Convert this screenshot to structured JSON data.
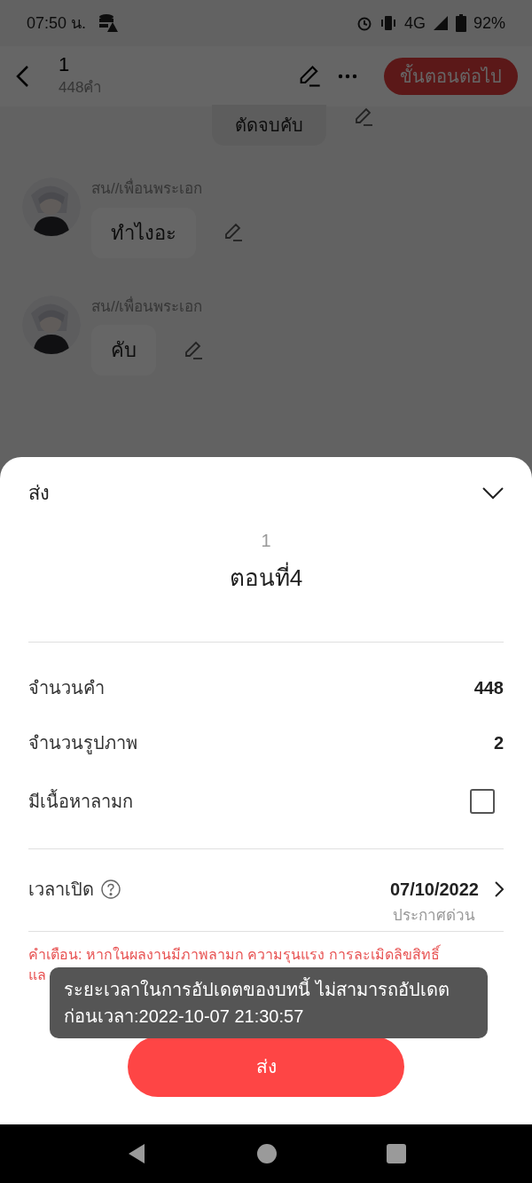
{
  "status_bar": {
    "time": "07:50 น.",
    "battery": "92%",
    "network": "4G"
  },
  "header": {
    "title": "1",
    "subtitle": "448คำ",
    "next_button": "ขั้นตอนต่อไป"
  },
  "messages": [
    {
      "kind": "self",
      "text": "ตัดจบคับ"
    },
    {
      "kind": "character",
      "name": "สน//เพื่อนพระเอก",
      "text": "ทำไงอะ"
    },
    {
      "kind": "character",
      "name": "สน//เพื่อนพระเอก",
      "text": "คับ"
    }
  ],
  "sheet": {
    "title": "ส่ง",
    "work_title": "1",
    "chapter_title": "ตอนที่4",
    "stats": [
      {
        "label": "จำนวนคำ",
        "value": "448"
      },
      {
        "label": "จำนวนรูปภาพ",
        "value": "2"
      }
    ],
    "adult_content": {
      "label": "มีเนื้อหาลามก",
      "checked": false
    },
    "release": {
      "label": "เวลาเปิด",
      "date": "07/10/2022",
      "note": "ประกาศด่วน"
    },
    "warning": [
      "คำเตือน: หากในผลงานมีภาพลามก ความรุนแรง การละเมิดลิขสิทธิ์",
      "แล"
    ],
    "submit_button": "ส่ง"
  },
  "toast": "ระยะเวลาในการอัปเดตของบทนี้ ไม่สามารถอัปเดตก่อนเวลา:2022-10-07 21:30:57"
}
